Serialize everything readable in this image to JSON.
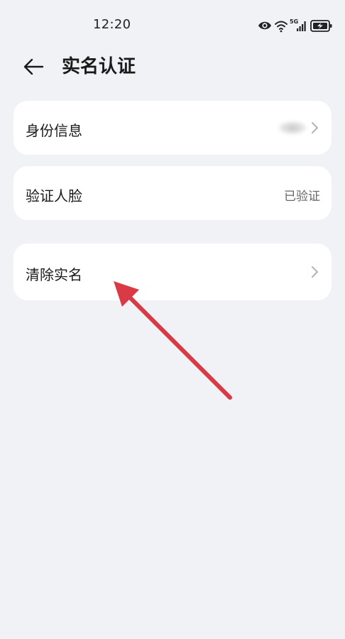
{
  "status_bar": {
    "time": "12:20",
    "network_label": "5G",
    "icons": [
      "eye-icon",
      "wifi-icon",
      "signal-icon",
      "battery-icon"
    ]
  },
  "header": {
    "title": "实名认证",
    "back_icon": "back-arrow-icon"
  },
  "items": [
    {
      "label": "身份信息",
      "value": "",
      "value_obscured": true,
      "has_chevron": true
    },
    {
      "label": "验证人脸",
      "value": "已验证",
      "has_chevron": false
    },
    {
      "label": "清除实名",
      "value": "",
      "has_chevron": true
    }
  ],
  "annotation": {
    "type": "arrow",
    "color": "#d93a45",
    "points_to": "清除实名"
  },
  "colors": {
    "background": "#f1f2f5",
    "card": "#ffffff",
    "text_primary": "#1a1a1a",
    "text_secondary": "#666666",
    "chevron": "#b3b3b3"
  }
}
